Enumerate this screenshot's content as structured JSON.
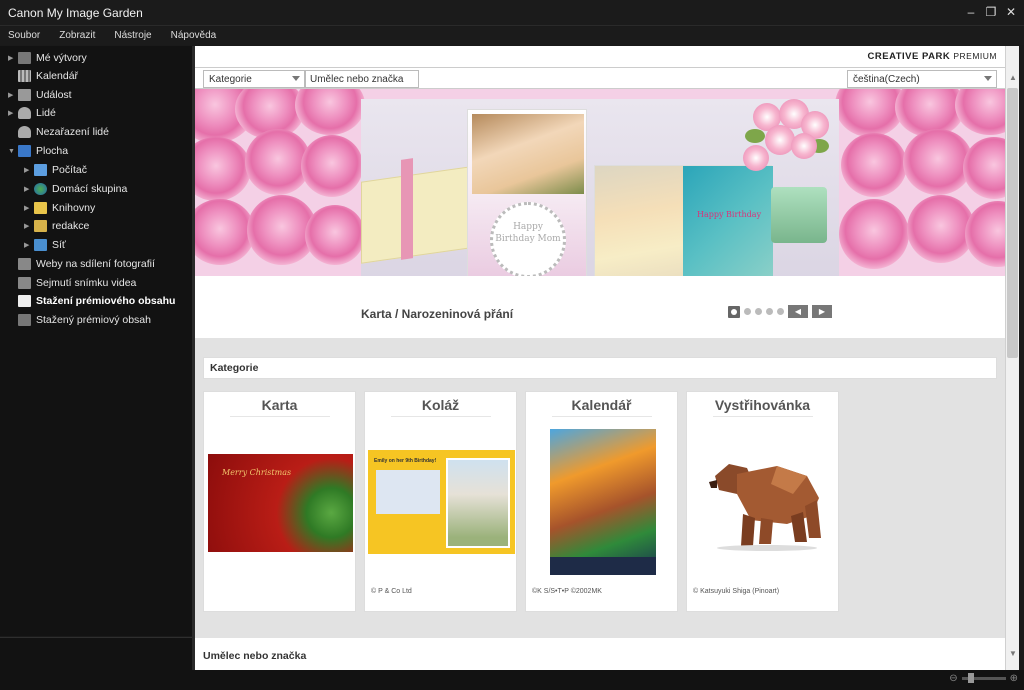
{
  "window": {
    "title": "Canon My Image Garden",
    "controls": [
      "minimize",
      "restore",
      "close"
    ]
  },
  "menu": [
    "Soubor",
    "Zobrazit",
    "Nástroje",
    "Nápověda"
  ],
  "sidebar": {
    "items": [
      {
        "label": "Mé výtvory",
        "icon": "folder-icon",
        "expandable": true
      },
      {
        "label": "Kalendář",
        "icon": "calendar-icon",
        "expandable": false
      },
      {
        "label": "Událost",
        "icon": "event-icon",
        "expandable": true
      },
      {
        "label": "Lidé",
        "icon": "person-icon",
        "expandable": true
      },
      {
        "label": "Nezařazení lidé",
        "icon": "person-unknown-icon",
        "expandable": false
      },
      {
        "label": "Plocha",
        "icon": "desktop-icon",
        "expandable": true,
        "expanded": true
      },
      {
        "label": "Počítač",
        "icon": "computer-icon",
        "expandable": true,
        "indent": 1
      },
      {
        "label": "Domácí skupina",
        "icon": "homegroup-icon",
        "expandable": true,
        "indent": 1
      },
      {
        "label": "Knihovny",
        "icon": "libraries-icon",
        "expandable": true,
        "indent": 1
      },
      {
        "label": "redakce",
        "icon": "user-folder-icon",
        "expandable": true,
        "indent": 1
      },
      {
        "label": "Síť",
        "icon": "network-icon",
        "expandable": true,
        "indent": 1
      },
      {
        "label": "Weby na sdílení fotografií",
        "icon": "web-share-icon",
        "expandable": false
      },
      {
        "label": "Sejmutí snímku videa",
        "icon": "video-capture-icon",
        "expandable": false
      },
      {
        "label": "Stažení prémiového obsahu",
        "icon": "download-premium-icon",
        "expandable": false,
        "active": true
      },
      {
        "label": "Stažený prémiový obsah",
        "icon": "downloaded-folder-icon",
        "expandable": false
      }
    ]
  },
  "header": {
    "brand_main": "CREATIVE PARK",
    "brand_sub": "PREMIUM"
  },
  "filters": {
    "category_select": "Kategorie",
    "artist_input": "Umělec nebo značka",
    "language_select": "čeština(Czech)"
  },
  "banner": {
    "card_text_pink": "Happy Birthday Mom",
    "card_text_blue": "Happy Birthday",
    "caption": "Karta / Narozeninová přání",
    "pager_count": 5,
    "pager_active": 1
  },
  "categories_section": {
    "title": "Kategorie",
    "cards": [
      {
        "title": "Karta",
        "copyright": "",
        "thumb_text": "Merry Christmas"
      },
      {
        "title": "Koláž",
        "copyright": "© P & Co Ltd",
        "thumb_text": "Emily on her 9th Birthday!"
      },
      {
        "title": "Kalendář",
        "copyright": "©K S/S•T•P ©2002MK",
        "thumb_text": ""
      },
      {
        "title": "Vystřihovánka",
        "copyright": "© Katsuyuki Shiga (Pinoart)",
        "thumb_text": ""
      }
    ]
  },
  "artists_section": {
    "title": "Umělec nebo značka"
  },
  "colors": {
    "sidebar_bg": "#121212",
    "content_bg": "#e2e2e2",
    "accent_pink": "#e983b6"
  }
}
